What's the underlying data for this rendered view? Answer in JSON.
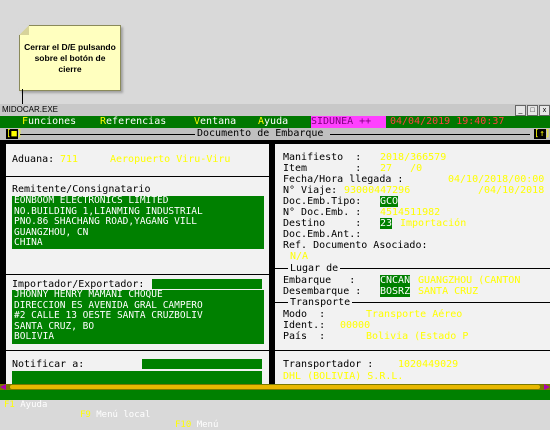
{
  "tooltip": {
    "text": "Cerrar el D/E pulsando sobre el botón de cierre"
  },
  "window": {
    "title": "MIDOCAR.EXE",
    "controls": [
      "_",
      "□",
      "x"
    ]
  },
  "menubar": {
    "items": [
      {
        "hot": "F",
        "rest": "unciones"
      },
      {
        "hot": "R",
        "rest": "eferencias"
      },
      {
        "hot": "V",
        "rest": "entana"
      },
      {
        "hot": "A",
        "rest": "yuda"
      }
    ],
    "system": "SIDUNEA ++",
    "datetime": "04/04/2019 19:40:37"
  },
  "header": {
    "left_indicator": "[■]",
    "title": "Documento de Embarque",
    "right_indicator": "[↑]"
  },
  "left": {
    "aduana": {
      "label": "Aduana:",
      "code": "711",
      "name": "Aeropuerto Viru-Viru"
    },
    "remitente": {
      "label": "Remitente/Consignatario",
      "lines": [
        "EONBOOM ELECTRONICS LIMITED",
        "NO.BUILDING 1,LIANMING INDUSTRIAL",
        "PNO.86 SHACHANG ROAD,YAGANG VILL",
        "GUANGZHOU, CN",
        "CHINA"
      ]
    },
    "importador": {
      "label": "Importador/Exportador:",
      "lines": [
        "JHONNY HENRY MAMANI CHOQUE",
        "DIRECCION ES AVENIDA GRAL CAMPERO",
        "#2 CALLE 13 OESTE SANTA CRUZBOLIV",
        "SANTA CRUZ, BO",
        "BOLIVIA"
      ]
    },
    "notificar": {
      "label": "Notificar a:"
    }
  },
  "right": {
    "manifiesto": {
      "label": "Manifiesto  :",
      "value": "2018/366579"
    },
    "item": {
      "label": "Item        :",
      "value": "27   /0"
    },
    "fecha": {
      "label": "Fecha/Hora llegada :",
      "value": "04/10/2018/00:00"
    },
    "viaje": {
      "label": "N° Viaje:",
      "value": "93000447296",
      "date": "/04/10/2018"
    },
    "tipo": {
      "label": "Doc.Emb.Tipo:",
      "value": "GCO"
    },
    "docemb": {
      "label": "N° Doc.Emb. :",
      "value": "4514511982"
    },
    "destino": {
      "label": "Destino     :",
      "code": "23",
      "value": "Importación"
    },
    "ant": {
      "label": "Doc.Emb.Ant.:"
    },
    "ref": {
      "label": "Ref. Documento Asociado:",
      "value": "N/A"
    },
    "lugar": {
      "label": "Lugar de"
    },
    "embarque": {
      "label": "Embarque   :",
      "code": "CNCAN",
      "value": "GUANGZHOU (CANTON"
    },
    "desembarque": {
      "label": "Desembarque :",
      "code": "BOSRZ",
      "value": "SANTA CRUZ"
    },
    "transporte": {
      "label": "Transporte"
    },
    "modo": {
      "label": "Modo  :",
      "value": "Transporte Aéreo"
    },
    "ident": {
      "label": "Ident.:",
      "value": "00000"
    },
    "pais": {
      "label": "País  :",
      "value": "Bolivia (Estado P"
    },
    "transportador": {
      "label": "Transportador :",
      "value": "1020449029",
      "name": "DHL (BOLIVIA) S.R.L."
    }
  },
  "statusbar": {
    "items": [
      {
        "key": "F1",
        "label": "Ayuda"
      },
      {
        "key": "F9",
        "label": "Menú local"
      },
      {
        "key": "F10",
        "label": "Menú"
      }
    ]
  }
}
